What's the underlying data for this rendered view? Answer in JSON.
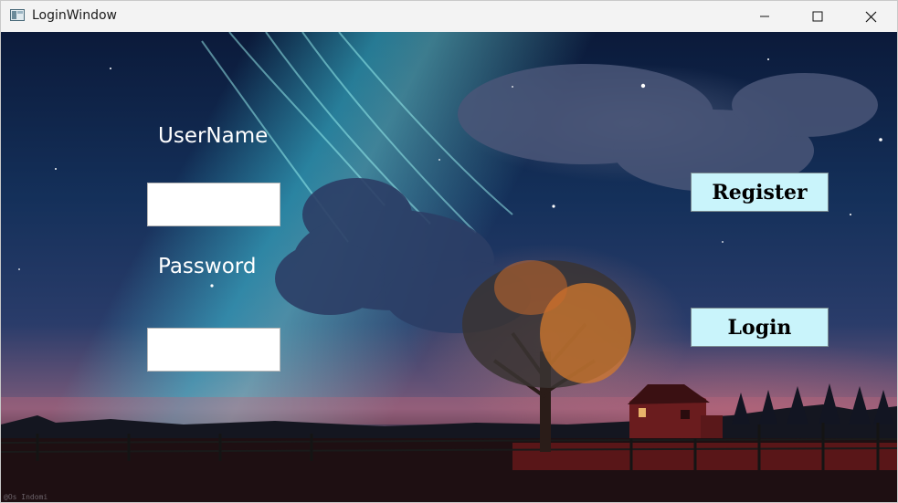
{
  "window": {
    "title": "LoginWindow",
    "controls": {
      "minimize": "minimize",
      "maximize": "maximize",
      "close": "close"
    }
  },
  "form": {
    "username_label": "UserName",
    "username_value": "",
    "password_label": "Password",
    "password_value": ""
  },
  "actions": {
    "register_label": "Register",
    "login_label": "Login"
  },
  "background": {
    "watermark": "@Os Indomi"
  },
  "colors": {
    "titlebar": "#f3f3f3",
    "button_fill": "#c9f4fb",
    "label_text": "#ffffff"
  },
  "icons": {
    "app": "window-app-icon",
    "minimize": "minimize-icon",
    "maximize": "maximize-icon",
    "close": "close-icon"
  }
}
